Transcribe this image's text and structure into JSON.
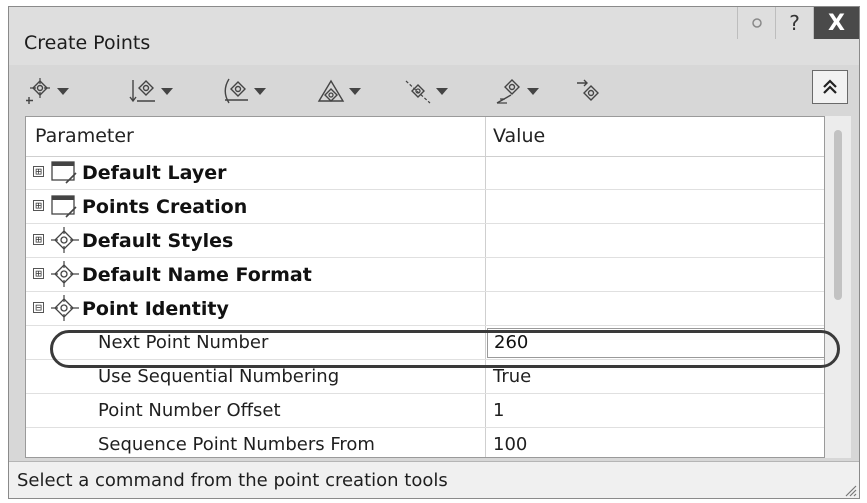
{
  "window": {
    "title": "Create Points",
    "help_label": "?",
    "close_label": "X"
  },
  "toolbar": {
    "tools": [
      {
        "icon": "point-add-icon",
        "has_dropdown": true
      },
      {
        "icon": "point-offset-icon",
        "has_dropdown": true
      },
      {
        "icon": "point-intersection-icon",
        "has_dropdown": true
      },
      {
        "icon": "point-surface-icon",
        "has_dropdown": true
      },
      {
        "icon": "point-interpolation-icon",
        "has_dropdown": true
      },
      {
        "icon": "point-alignment-icon",
        "has_dropdown": true
      },
      {
        "icon": "point-convert-icon",
        "has_dropdown": false
      }
    ],
    "collapse_icon": "double-chevron-up-icon"
  },
  "grid": {
    "columns": [
      "Parameter",
      "Value"
    ],
    "groups": [
      {
        "label": "Default Layer",
        "expander": "⊞",
        "icon": "layer-icon"
      },
      {
        "label": "Points Creation",
        "expander": "⊞",
        "icon": "layer-icon"
      },
      {
        "label": "Default Styles",
        "expander": "⊞",
        "icon": "point-style-icon"
      },
      {
        "label": "Default Name Format",
        "expander": "⊞",
        "icon": "point-style-icon"
      },
      {
        "label": "Point Identity",
        "expander": "⊟",
        "icon": "point-style-icon"
      }
    ],
    "rows": [
      {
        "param": "Next Point Number",
        "value": "260"
      },
      {
        "param": "Use Sequential Numbering",
        "value": "True"
      },
      {
        "param": "Point Number Offset",
        "value": "1"
      },
      {
        "param": "Sequence Point Numbers From",
        "value": "100"
      }
    ]
  },
  "status_bar": {
    "text": "Select a command from the point creation tools"
  }
}
